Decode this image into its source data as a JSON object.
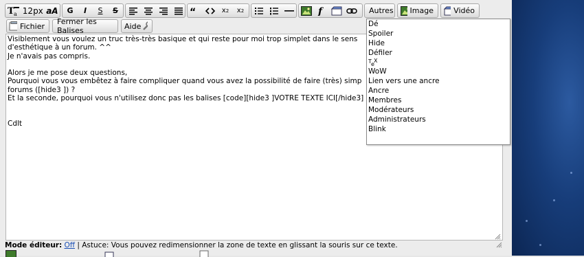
{
  "toolbar": {
    "font_size": "12px",
    "autres_label": "Autres",
    "image_label": "Image",
    "video_label": "Vidéo",
    "bold_label": "G",
    "italic_label": "I",
    "underline_label": "S",
    "strike_label": "S",
    "sub_label": "x",
    "sub_index": "2",
    "sup_label": "x",
    "sup_index": "2",
    "quote_label": "66"
  },
  "toolbar2": {
    "fichier_label": "Fichier",
    "fermer_label": "Fermer les Balises",
    "aide_label": "Aide"
  },
  "editor": {
    "text": "Visiblement vous voulez un truc très-très basique et qui reste pour moi trop simplet dans le sens\nd'esthétique à un forum. ^^\nJe n'avais pas compris.\n\nAlors je me pose deux questions,\nPourquoi vous vous embêtez à faire compliquer quand vous avez la possibilité de faire (très) simp\nforums ([hide3 ]) ?\nEt la seconde, pourquoi vous n'utilisez donc pas les balises [code][hide3 ]VOTRE TEXTE ICI[/hide3]\n\n\nCdlt"
  },
  "autres_menu": {
    "items": [
      "Dé",
      "Spoiler",
      "Hide",
      "Défiler",
      "T",
      "WoW",
      "Lien vers une ancre",
      "Ancre",
      "Membres",
      "Modérateurs",
      "Administrateurs",
      "Blink"
    ],
    "tex_sub": "e",
    "tex_sup": "X"
  },
  "status": {
    "mode_label": "Mode éditeur:",
    "mode_value": "Off",
    "tip": " | Astuce: Vous pouvez redimensionner la zone de texte en glissant la souris sur ce texte."
  },
  "colors": {
    "link": "#1a4fb5",
    "wallpaper": "#173d7a"
  }
}
